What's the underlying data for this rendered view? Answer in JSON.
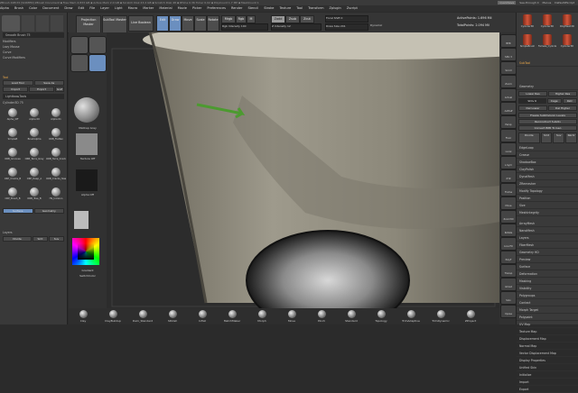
{
  "window": {
    "title": "ZBrush 4R8 P2 [SCREEN] ZBrush Document   ▪ Free Mem 4.833 GB ▪ Active Mem 2.0 GB ▪ Scratch Disk 43.2 GB ▪ Scratch Disk 48 ▪ RTime 0.36 Timer 0.02 ▪ PolyCount 1.7 MP ▪ MeshCount 1",
    "quicksave": "QuickSave",
    "see_through": "See-through 0",
    "menus_label": "Menus",
    "default_zscript": "DefaultZScript"
  },
  "menubar": [
    "Alpha",
    "Brush",
    "Color",
    "Document",
    "Draw",
    "Edit",
    "File",
    "Layer",
    "Light",
    "Macro",
    "Marker",
    "Material",
    "Movie",
    "Picker",
    "Preferences",
    "Render",
    "Stencil",
    "Stroke",
    "Texture",
    "Tool",
    "Transform",
    "Zplugin",
    "Zscript"
  ],
  "shelf": {
    "projection_master": "Projection Master",
    "lightbox": "LightBox",
    "subtool_master": "SubTool Master",
    "live_boolean": "Live Boolean",
    "edit": "Edit",
    "draw": "Draw",
    "move": "Move",
    "scale": "Scale",
    "rotate": "Rotate",
    "mrgb": "Mrgb",
    "rgb": "Rgb",
    "m": "M",
    "zadd": "Zadd",
    "zsub": "Zsub",
    "zcut": "Zcut",
    "rgb_intensity": "Rgb Intensity 100",
    "z_intensity": "Z Intensity 12",
    "focal_shift": "Focal Shift 0",
    "draw_size": "Draw Size 201",
    "dynamic": "Dynamic",
    "active_points": "ActivePoints: 1.696 Mil",
    "total_points": "TotalPoints: 2.094 Mil"
  },
  "left_panel": {
    "top_icons": [
      "Standard",
      "Curve",
      "Circle",
      "Dots"
    ],
    "smooth_brush": "Smooth Brush 75",
    "sections": [
      "Modifiers",
      "Lazy Mouse",
      "Curve",
      "Curve Modifiers"
    ],
    "tool_header": "Tool",
    "load_tool": "Load Tool",
    "save_as": "Save As",
    "import": "Import",
    "export": "Export",
    "goz": "GoZ",
    "all": "All",
    "visible": "Visible",
    "r": "R",
    "lightbox_tools": "Lightbox▸Tools",
    "current_tool": "Cylinder3D 75",
    "tool_thumbs": [
      "Alpha_Off",
      "Alpha 00",
      "Alpha 01",
      "SimpleB",
      "BrushAlpha",
      "ORB_Flatten",
      "ORB_Grooves",
      "ORB_Terra_Gray",
      "ORB_Terra_Crackle",
      "CRP_Cracks_B",
      "CRP_Deep_A",
      "ORB_Cracks_Slash",
      "CRP_Brush_B",
      "ORB_Tree_B",
      "HS_Incision"
    ],
    "surface": "Surface",
    "geometry": "Geometry",
    "layers": "Layers",
    "divide": "Divide",
    "smt": "Smt",
    "suv": "Suv",
    "reuv": "ReUV"
  },
  "tool_strip": {
    "labels": [
      "BPR",
      "SPix 3",
      "Scroll",
      "Zoom",
      "Actual",
      "AAHalf",
      "Persp",
      "Floor",
      "Local",
      "L.Sym",
      "XYZ",
      "Frame",
      "Move",
      "Zoom3D",
      "Rotate",
      "Line Fill",
      "PolyF",
      "Transp",
      "Ghost",
      "Solo",
      "Xpose"
    ],
    "material": "MatCap Gray",
    "texture": "Texture Off",
    "alpha": "Alpha Off",
    "gradient": "Gradient",
    "switch_color": "SwitchColor",
    "alternate": "Alternate",
    "dots": "Dots"
  },
  "right_panel": {
    "tool_thumbs": [
      "Cylinder3D",
      "Cylinder3D",
      "PolyMesh3D",
      "SimpleBrush",
      "Female_Cylinder",
      "Cylinder3D"
    ],
    "subtool": "SubTool",
    "geometry": "Geometry",
    "lower_res": "Lower Res",
    "higher_res": "Higher Res",
    "sdiv": "SDiv 6",
    "cage": "Cage",
    "rstr": "Rstr",
    "del_lower": "Del Lower",
    "del_higher": "Del Higher",
    "freeze": "Freeze SubDivision Levels",
    "reconstruct": "Reconstruct Subdiv",
    "convert_bpr": "Convert BPR To Geo",
    "divide": "Divide",
    "smt": "Smt",
    "suv": "Suv",
    "reuv": "ReUV",
    "edgeloop": "EdgeLoop",
    "crease": "Crease",
    "shadowbox": "ShadowBox",
    "claypolish": "ClayPolish",
    "dynamesh": "DynaMesh",
    "zremesher": "ZRemesher",
    "modify_topology": "Modify Topology",
    "position": "Position",
    "size": "Size",
    "meshintegrity": "MeshIntegrity",
    "items": [
      "ArrayMesh",
      "NanoMesh",
      "Layers",
      "FiberMesh",
      "Geometry HD",
      "Preview",
      "Surface",
      "Deformation",
      "Masking",
      "Visibility",
      "Polygroups",
      "Contact",
      "Morph Target",
      "Polypaint",
      "UV Map",
      "Texture Map",
      "Displacement Map",
      "Normal Map",
      "Vector Displacement Map",
      "Display Properties",
      "Unified Skin",
      "Initialize",
      "Import",
      "Export"
    ]
  },
  "bottom_bar": [
    "Clay",
    "ClayBuildup",
    "Dam_Standard",
    "hPolish",
    "Inflat",
    "MatchMaker",
    "Morph",
    "Move",
    "Pinch",
    "Standard",
    "Topology",
    "TrimAdaptive",
    "TrimDynamic",
    "ZProject"
  ]
}
